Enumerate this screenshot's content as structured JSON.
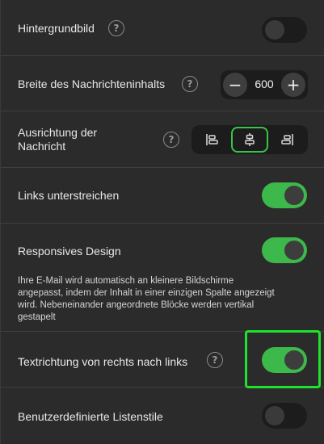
{
  "settings": {
    "background_image": {
      "label": "Hintergrundbild",
      "enabled": false
    },
    "content_width": {
      "label": "Breite des Nachrichteninhalts",
      "value": "600",
      "minus": "−",
      "plus": "+"
    },
    "alignment": {
      "label_line1": "Ausrichtung der",
      "label_line2": "Nachricht",
      "options": [
        "left-align-icon",
        "center-align-icon",
        "right-align-icon"
      ],
      "selected": "center"
    },
    "underline_links": {
      "label": "Links unterstreichen",
      "enabled": true
    },
    "responsive": {
      "label": "Responsives Design",
      "enabled": true,
      "desc_line1": "Ihre E-Mail wird automatisch an kleinere Bildschirme",
      "desc_line2": "angepasst, indem der Inhalt in einer einzigen Spalte angezeigt",
      "desc_line3": "wird. Nebeneinander angeordnete Blöcke werden vertikal",
      "desc_line4": "gestapelt"
    },
    "rtl": {
      "label": "Textrichtung von rechts nach links",
      "enabled": true
    },
    "custom_list_styles": {
      "label": "Benutzerdefinierte Listenstile",
      "enabled": false
    },
    "help_glyph": "?"
  },
  "colors": {
    "toggle_on": "#3cb94a",
    "highlight": "#1fe22c",
    "background": "#2b2b2b"
  }
}
